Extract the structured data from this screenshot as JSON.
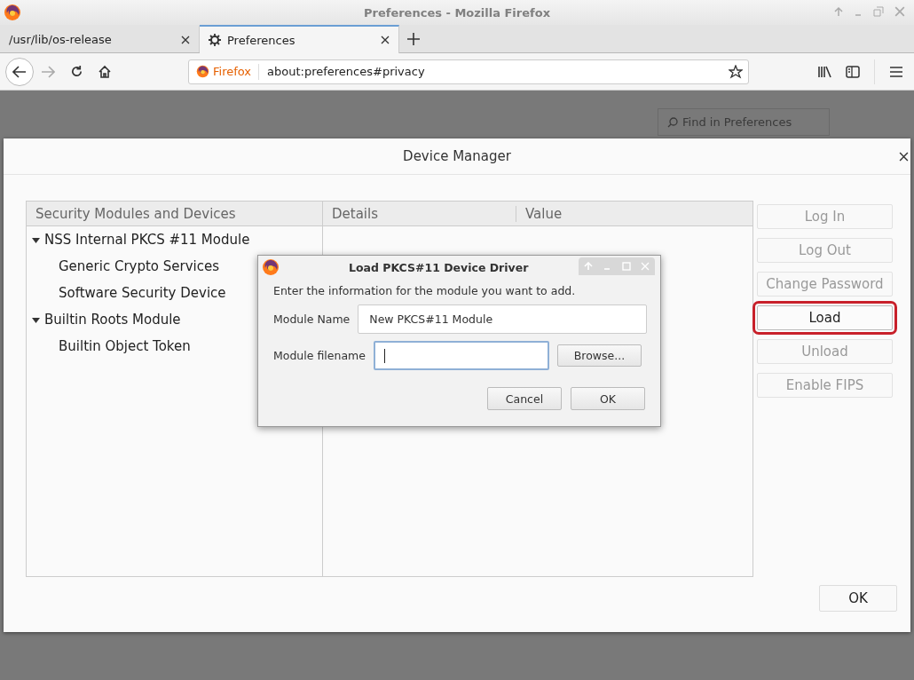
{
  "window": {
    "title": "Preferences - Mozilla Firefox"
  },
  "tabs": [
    {
      "label": "/usr/lib/os-release",
      "selected": false
    },
    {
      "label": "Preferences",
      "selected": true
    }
  ],
  "url_bar": {
    "identity": "Firefox",
    "url": "about:preferences#privacy"
  },
  "search": {
    "placeholder": "Find in Preferences"
  },
  "device_manager": {
    "title": "Device Manager",
    "columns": [
      "Security Modules and Devices",
      "Details",
      "Value"
    ],
    "tree": [
      {
        "label": "NSS Internal PKCS #11 Module",
        "expanded": true,
        "children": [
          {
            "label": "Generic Crypto Services"
          },
          {
            "label": "Software Security Device"
          }
        ]
      },
      {
        "label": "Builtin Roots Module",
        "expanded": true,
        "children": [
          {
            "label": "Builtin Object Token"
          }
        ]
      }
    ],
    "buttons": [
      {
        "label": "Log In",
        "disabled": true,
        "highlighted": false
      },
      {
        "label": "Log Out",
        "disabled": true,
        "highlighted": false
      },
      {
        "label": "Change Password",
        "disabled": true,
        "highlighted": false
      },
      {
        "label": "Load",
        "disabled": false,
        "highlighted": true
      },
      {
        "label": "Unload",
        "disabled": true,
        "highlighted": false
      },
      {
        "label": "Enable FIPS",
        "disabled": true,
        "highlighted": false
      }
    ],
    "ok": "OK"
  },
  "load_dialog": {
    "title": "Load PKCS#11 Device Driver",
    "prompt": "Enter the information for the module you want to add.",
    "fields": [
      {
        "label": "Module Name",
        "value": "New PKCS#11 Module",
        "focused": false
      },
      {
        "label": "Module filename",
        "focused": true,
        "button": "Browse..."
      }
    ],
    "buttons": [
      "Cancel",
      "OK"
    ]
  }
}
